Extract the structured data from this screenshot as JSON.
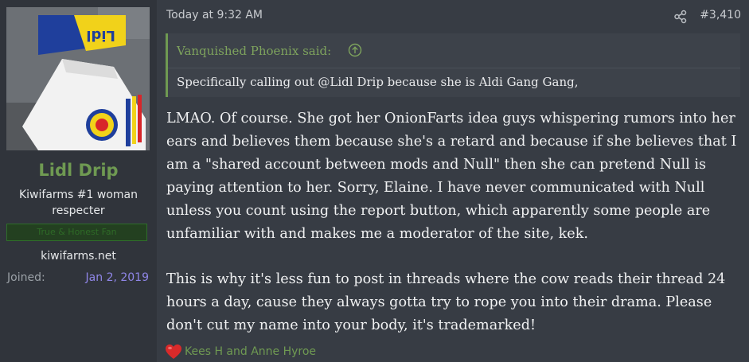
{
  "user": {
    "name": "Lidl Drip",
    "title": "Kiwifarms #1 woman respecter",
    "banner": "True & Honest Fan",
    "site": "kiwifarms.net",
    "joined_label": "Joined:",
    "joined_date": "Jan 2, 2019",
    "avatar_text": "Lidl"
  },
  "post": {
    "timestamp": "Today at 9:32 AM",
    "number": "#3,410"
  },
  "quote": {
    "author_said": "Vanquished Phoenix said:",
    "text": "Specifically calling out @Lidl Drip because she is Aldi Gang Gang,"
  },
  "message": {
    "paragraph1": "LMAO. Of course. She got her OnionFarts idea guys whispering rumors into her ears and believes them because she's a retard and because if she believes that I am a \"shared account between mods and Null\" then she can pretend Null is paying attention to her. Sorry, Elaine. I have never communicated with Null unless you count using the report button, which apparently some people are unfamiliar with and makes me a moderator of the site, kek.",
    "paragraph2": "This is why it's less fun to post in threads where the cow reads their thread 24 hours a day, cause they always gotta try to rope you into their drama. Please don't cut my name into your body, it's trademarked!"
  },
  "reactions": {
    "icon": "heart-icon",
    "text": "Kees H and Anne Hyroe"
  },
  "colors": {
    "accent_green": "#6f9a52",
    "joined_date": "#8f86e8",
    "background": "#373c44",
    "sidebar": "#30343b"
  }
}
